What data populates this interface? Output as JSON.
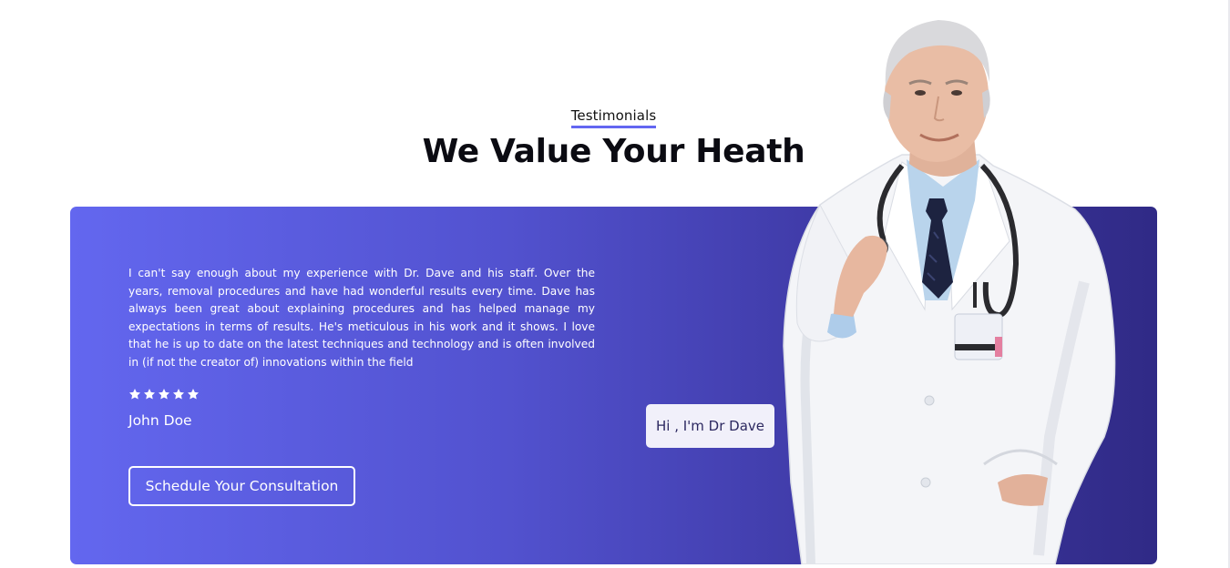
{
  "section": {
    "label": "Testimonials",
    "title": "We Value Your Heath"
  },
  "testimonial": {
    "quote": "I can't say enough about my experience with Dr. Dave and his staff. Over the years, removal procedures and have had wonderful results every time. Dave has always been great about explaining procedures and has helped manage my expectations in terms of results. He's meticulous in his work and it shows. I love that he is up to date on the latest techniques and technology and is often involved in (if not the creator of) innovations within the field",
    "rating": 5,
    "rating_max": 5,
    "author": "John Doe"
  },
  "cta": {
    "label": "Schedule Your Consultation"
  },
  "doctor": {
    "greeting": "Hi , I'm Dr Dave"
  },
  "colors": {
    "accent": "#6366f1",
    "card_gradient_start": "#6367ef",
    "card_gradient_end": "#302a86",
    "chip_bg": "#f1f0fa",
    "star": "#ffffff"
  },
  "icons": {
    "star": "star-icon",
    "doctor": "doctor-portrait-illustration"
  }
}
